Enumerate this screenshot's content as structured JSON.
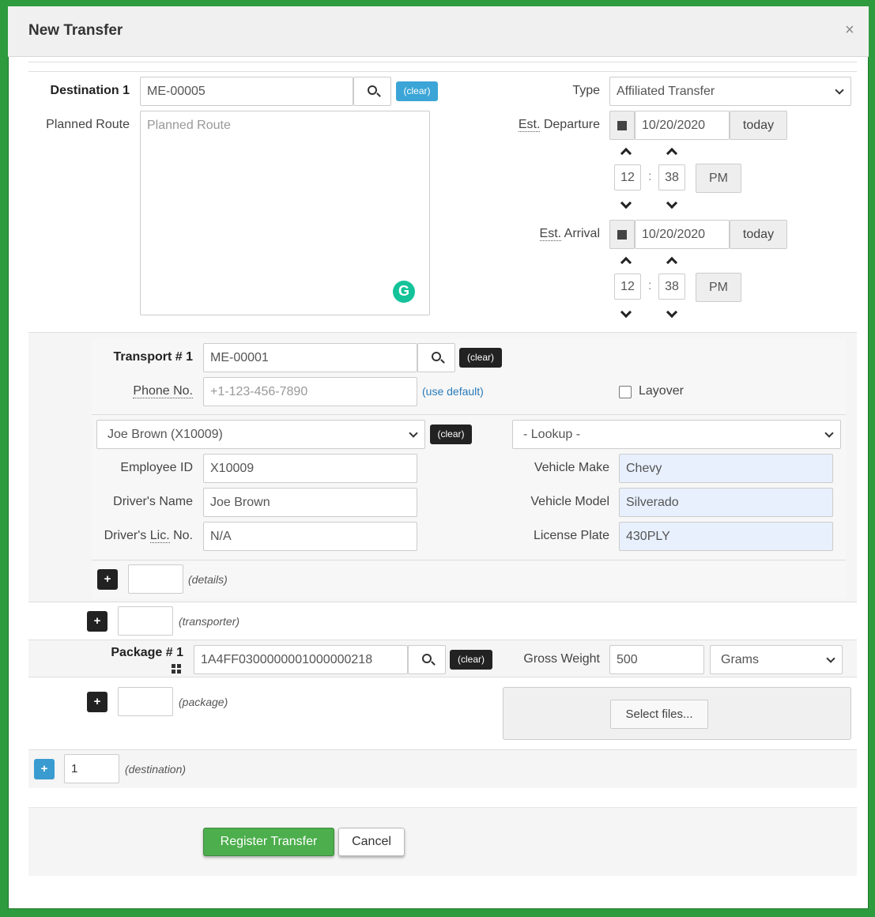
{
  "dialog": {
    "title": "New Transfer",
    "close_label": "×"
  },
  "destination": {
    "label": "Destination 1",
    "value": "ME-00005",
    "clear_label": "(clear)",
    "route_label": "Planned Route",
    "route_placeholder": "Planned Route"
  },
  "type": {
    "label": "Type",
    "value": "Affiliated Transfer"
  },
  "departure": {
    "label_abbr": "Est.",
    "label_rest": " Departure",
    "date": "10/20/2020",
    "today_label": "today",
    "hour": "12",
    "minute": "38",
    "ampm": "PM",
    "sep": ":"
  },
  "arrival": {
    "label_abbr": "Est.",
    "label_rest": " Arrival",
    "date": "10/20/2020",
    "today_label": "today",
    "hour": "12",
    "minute": "38",
    "ampm": "PM",
    "sep": ":"
  },
  "transport": {
    "label": "Transport # 1",
    "value": "ME-00001",
    "clear_label": "(clear)",
    "phone_label": "Phone No.",
    "phone_placeholder": "+1-123-456-7890",
    "use_default_label": "(use default)",
    "layover_label": "Layover"
  },
  "driver": {
    "select_value": "Joe Brown (X10009)",
    "clear_label": "(clear)",
    "employee_id_label": "Employee ID",
    "employee_id": "X10009",
    "name_label": "Driver's Name",
    "name": "Joe Brown",
    "lic_label_pre": "Driver's ",
    "lic_label_abbr": "Lic.",
    "lic_label_post": " No.",
    "lic": "N/A"
  },
  "vehicle": {
    "lookup_value": "- Lookup -",
    "make_label": "Vehicle Make",
    "make": "Chevy",
    "model_label": "Vehicle Model",
    "model": "Silverado",
    "plate_label": "License Plate",
    "plate": "430PLY"
  },
  "details": {
    "hint": "(details)"
  },
  "transporter": {
    "hint": "(transporter)"
  },
  "package": {
    "label": "Package # 1",
    "value": "1A4FF0300000001000000218",
    "clear_label": "(clear)",
    "gross_weight_label": "Gross Weight",
    "gross_weight": "500",
    "unit": "Grams",
    "hint": "(package)",
    "select_files_label": "Select files..."
  },
  "destination_add": {
    "count": "1",
    "hint": "(destination)"
  },
  "footer": {
    "register_label": "Register Transfer",
    "cancel_label": "Cancel"
  },
  "colors": {
    "frame": "#2e9b3e",
    "register": "#4cae4c",
    "clear_blue": "#3aa5d6",
    "autofill": "#e8f0fe"
  }
}
